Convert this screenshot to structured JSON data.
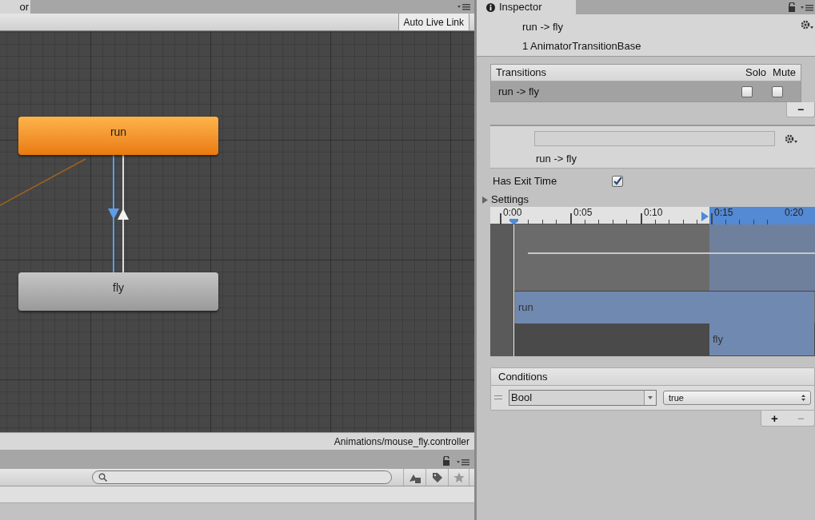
{
  "graph_tab": {
    "label": "or"
  },
  "graph": {
    "toolbar_button": "Auto Live Link",
    "nodes": [
      {
        "label": "run",
        "selected": true
      },
      {
        "label": "fly",
        "selected": false
      }
    ],
    "status_path": "Animations/mouse_fly.controller"
  },
  "inspector": {
    "tab": "Inspector",
    "title": "run -> fly",
    "subtitle": "1 AnimatorTransitionBase",
    "transitions": {
      "header": "Transitions",
      "solo_label": "Solo",
      "mute_label": "Mute",
      "rows": [
        {
          "name": "run -> fly",
          "selected": true,
          "solo": false,
          "mute": false
        }
      ]
    },
    "remove_button": "−",
    "name_caption": "run -> fly",
    "has_exit_time": {
      "label": "Has Exit Time",
      "checked": true
    },
    "settings": {
      "label": "Settings",
      "expanded": false
    },
    "timeline": {
      "ticks": [
        "0:00",
        "0:05",
        "0:10",
        "0:15",
        "0:20"
      ],
      "clips": [
        "run",
        "fly"
      ]
    },
    "conditions": {
      "header": "Conditions",
      "rows": [
        {
          "parameter": "Bool",
          "value": "true"
        }
      ]
    },
    "add_condition": "+",
    "remove_condition": "−"
  }
}
